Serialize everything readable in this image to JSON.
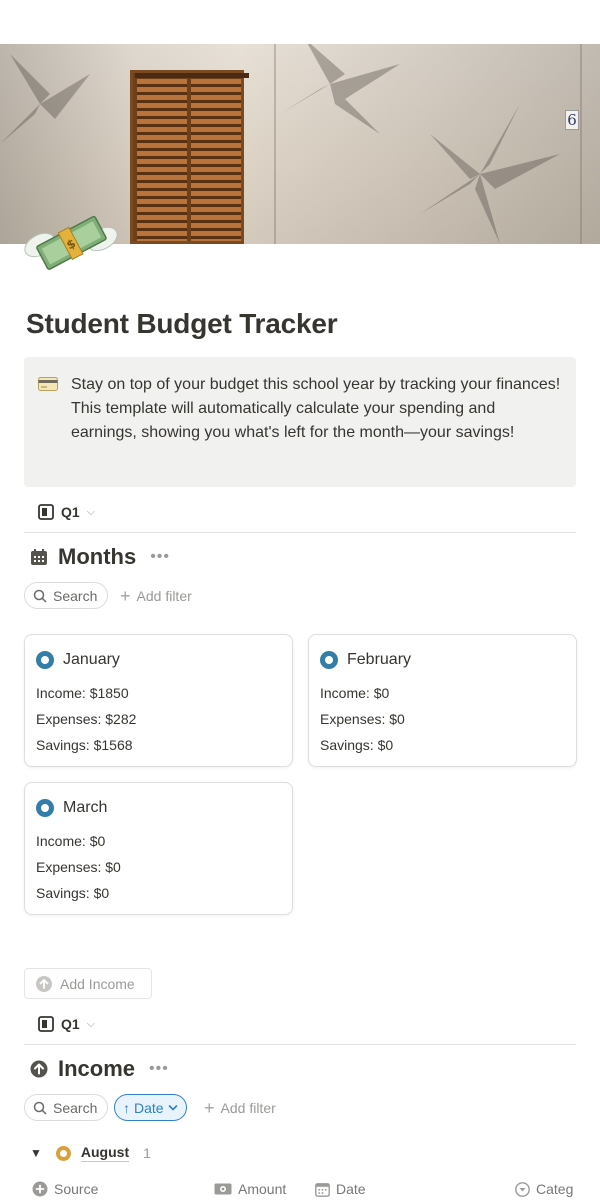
{
  "page": {
    "title": "Student Budget Tracker"
  },
  "callout": {
    "text": "Stay on top of your budget this school year by tracking your finances! This template will automatically calculate your spending and earnings, showing you what's left for the month—your savings!"
  },
  "cover": {
    "house_number": "6"
  },
  "months_section": {
    "view_tab": "Q1",
    "title": "Months",
    "search_label": "Search",
    "add_filter_label": "Add filter",
    "cards": [
      {
        "name": "January",
        "income": "Income: $1850",
        "expenses": "Expenses: $282",
        "savings": "Savings: $1568"
      },
      {
        "name": "February",
        "income": "Income: $0",
        "expenses": "Expenses: $0",
        "savings": "Savings: $0"
      },
      {
        "name": "March",
        "income": "Income: $0",
        "expenses": "Expenses: $0",
        "savings": "Savings: $0"
      }
    ]
  },
  "add_income_button": "Add Income",
  "income_section": {
    "view_tab": "Q1",
    "title": "Income",
    "search_label": "Search",
    "sort_label": "Date",
    "add_filter_label": "Add filter",
    "group": {
      "name": "August",
      "count": "1"
    },
    "columns": [
      "Source",
      "Amount",
      "Date",
      "Categ"
    ]
  },
  "colors": {
    "text": "#37352f",
    "muted": "#9b9a97",
    "month_icon": "#337ea9",
    "group_dot": "#d9a13b",
    "sort_accent": "#2f80c8",
    "callout_bg": "#f1f1ef"
  },
  "icons": {
    "page_icon": "money-with-wings-icon",
    "callout_icon": "credit-card-icon",
    "view_icon": "board-view-icon",
    "months_icon": "calendar-icon",
    "income_icon": "arrow-up-circle-icon"
  }
}
